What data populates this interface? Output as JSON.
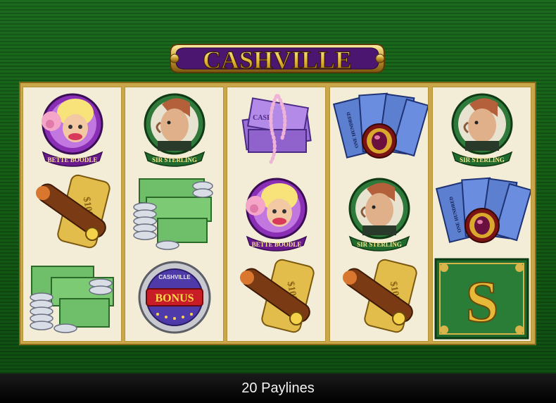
{
  "game": {
    "title": "CASHVILLE",
    "paylines_label": "20 Paylines"
  },
  "colors": {
    "felt_green": "#166017",
    "reel_background": "#f3ecd6",
    "gold_frame": "#c9a648",
    "logo_purple": "#5a1d86"
  },
  "reels": [
    {
      "symbols": [
        {
          "name": "bette-boodle",
          "label": "BETTE BOODLE"
        },
        {
          "name": "cigar-gold",
          "label": "$100"
        },
        {
          "name": "cash-stack",
          "label": ""
        }
      ]
    },
    {
      "symbols": [
        {
          "name": "sir-sterling",
          "label": "SIR STERLING"
        },
        {
          "name": "cash-stack",
          "label": ""
        },
        {
          "name": "bonus-coin",
          "label": "BONUS",
          "ring_label": "CASHVILLE"
        }
      ]
    },
    {
      "symbols": [
        {
          "name": "purple-cash-pearls",
          "label": "CASH"
        },
        {
          "name": "bette-boodle",
          "label": "BETTE BOODLE"
        },
        {
          "name": "cigar-gold",
          "label": "$100"
        }
      ]
    },
    {
      "symbols": [
        {
          "name": "blue-bills-ruby",
          "label": "ONE HUNDRED"
        },
        {
          "name": "sir-sterling",
          "label": "SIR STERLING"
        },
        {
          "name": "cigar-gold",
          "label": "$100"
        }
      ]
    },
    {
      "symbols": [
        {
          "name": "sir-sterling",
          "label": "SIR STERLING"
        },
        {
          "name": "blue-bills-ruby",
          "label": "ONE HUNDRED"
        },
        {
          "name": "gold-s-scatter",
          "label": "S"
        }
      ]
    }
  ]
}
